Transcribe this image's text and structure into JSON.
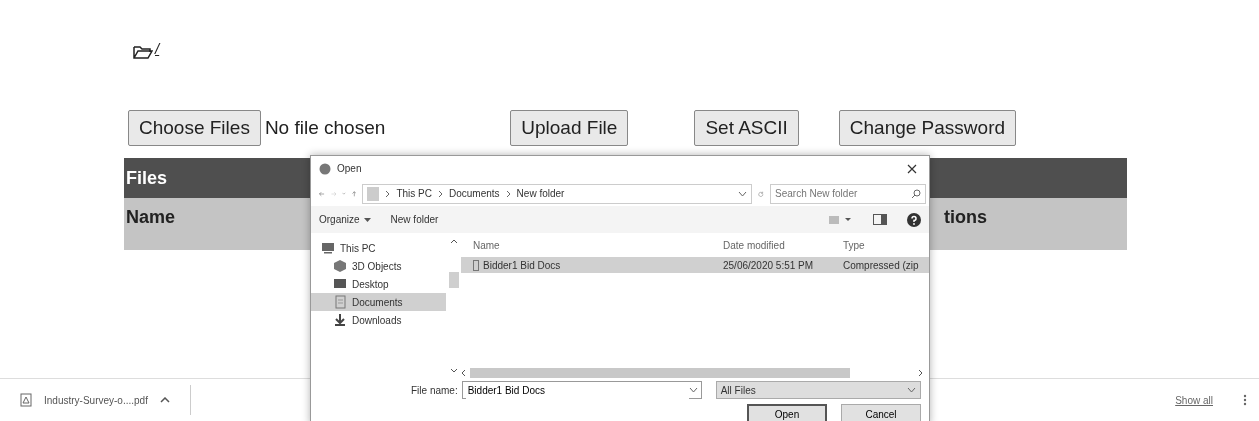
{
  "page": {
    "path": "/",
    "file_input": {
      "button": "Choose Files",
      "status": "No file chosen"
    },
    "buttons": [
      "Upload File",
      "Set ASCII",
      "Change Password"
    ],
    "table": {
      "title": "Files",
      "columns": [
        "Name",
        "tions"
      ]
    }
  },
  "dialog": {
    "title": "Open",
    "breadcrumb": [
      "This PC",
      "Documents",
      "New folder"
    ],
    "search": {
      "placeholder": "Search New folder"
    },
    "toolbar": [
      "Organize",
      "New folder"
    ],
    "nav_items": [
      {
        "label": "This PC",
        "kind": "pc",
        "selected": false,
        "children": [
          {
            "label": "3D Objects",
            "kind": "cube",
            "selected": false
          },
          {
            "label": "Desktop",
            "kind": "desktop",
            "selected": false
          },
          {
            "label": "Documents",
            "kind": "document",
            "selected": true
          },
          {
            "label": "Downloads",
            "kind": "download",
            "selected": false
          }
        ]
      }
    ],
    "columns": [
      "Name",
      "Date modified",
      "Type"
    ],
    "files": [
      {
        "name": "Bidder1 Bid Docs",
        "date": "25/06/2020 5:51 PM",
        "type": "Compressed (zip",
        "selected": true
      }
    ],
    "file_name_label": "File name:",
    "file_name": "Bidder1 Bid Docs",
    "file_type": "All Files",
    "buttons": [
      {
        "label": "Open",
        "default": true
      },
      {
        "label": "Cancel",
        "default": false
      }
    ]
  },
  "download_bar": {
    "file": "Industry-Survey-o....pdf",
    "show_all": "Show all"
  }
}
